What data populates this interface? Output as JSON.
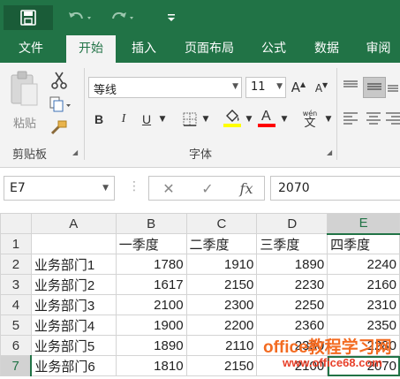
{
  "quick_access": {
    "save_icon": "save-icon",
    "undo_icon": "undo-icon",
    "redo_icon": "redo-icon",
    "customize_icon": "customize-icon"
  },
  "tabs": {
    "file": "文件",
    "home": "开始",
    "insert": "插入",
    "page_layout": "页面布局",
    "formulas": "公式",
    "data": "数据",
    "review": "审阅"
  },
  "ribbon": {
    "clipboard": {
      "paste_label": "粘贴",
      "group_label": "剪贴板"
    },
    "font": {
      "font_name": "等线",
      "font_size": "11",
      "bold": "B",
      "italic": "I",
      "underline": "U",
      "font_color_letter": "A",
      "phonetic_top": "wén",
      "phonetic_char": "文",
      "group_label": "字体"
    }
  },
  "formula_bar": {
    "name_box": "E7",
    "fx_label": "fx",
    "formula_value": "2070"
  },
  "sheet": {
    "column_headers": [
      "A",
      "B",
      "C",
      "D",
      "E"
    ],
    "active_column": "E",
    "active_row": "7",
    "rows": [
      {
        "row": "1",
        "cells": [
          "",
          "一季度",
          "二季度",
          "三季度",
          "四季度"
        ]
      },
      {
        "row": "2",
        "cells": [
          "业务部门1",
          "1780",
          "1910",
          "1890",
          "2240"
        ]
      },
      {
        "row": "3",
        "cells": [
          "业务部门2",
          "1617",
          "2150",
          "2230",
          "2160"
        ]
      },
      {
        "row": "4",
        "cells": [
          "业务部门3",
          "2100",
          "2300",
          "2250",
          "2310"
        ]
      },
      {
        "row": "5",
        "cells": [
          "业务部门4",
          "1900",
          "2200",
          "2360",
          "2350"
        ]
      },
      {
        "row": "6",
        "cells": [
          "业务部门5",
          "1890",
          "2110",
          "2380",
          "2280"
        ]
      },
      {
        "row": "7",
        "cells": [
          "业务部门6",
          "1810",
          "2150",
          "2100",
          "2070"
        ]
      }
    ]
  },
  "watermark": {
    "title": "office教程学习网",
    "url": "www.office68.com"
  },
  "colors": {
    "accent": "#217346",
    "highlight_yellow": "#ffff00",
    "font_red": "#ff0000",
    "watermark_orange": "#f36b21",
    "watermark_red": "#e8402a"
  }
}
